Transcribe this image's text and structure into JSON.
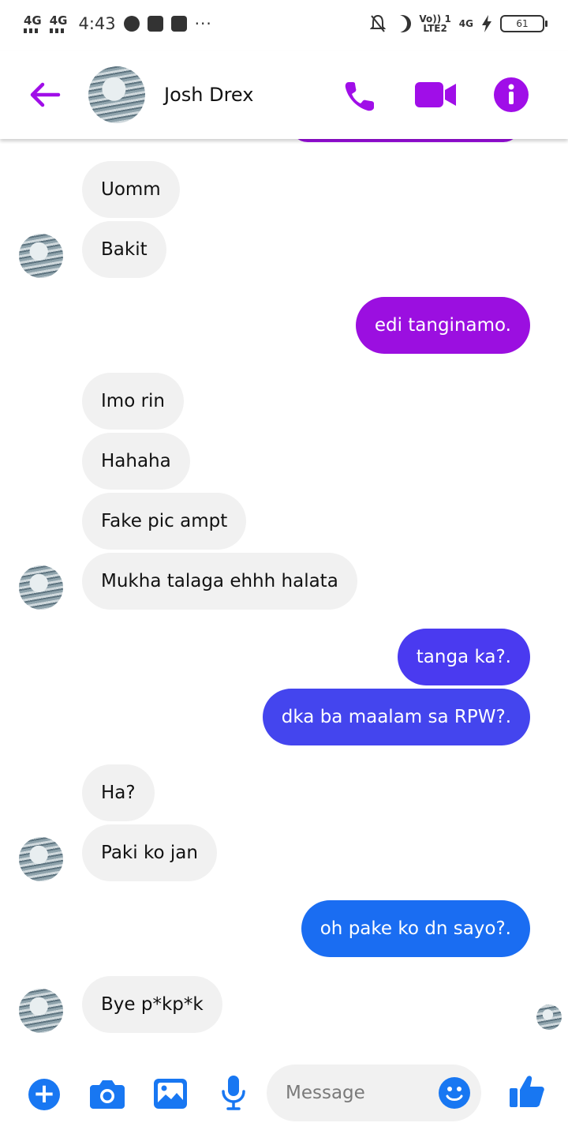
{
  "status_bar": {
    "network_1": "4G",
    "network_2": "4G",
    "time": "4:43",
    "volte_line1": "Vo)) 1",
    "volte_line2": "LTE2",
    "network_3": "4G",
    "battery": "61"
  },
  "header": {
    "contact_name": "Josh Drex"
  },
  "messages": [
    {
      "side": "in",
      "text": "Uomm"
    },
    {
      "side": "in",
      "text": "Bakit"
    },
    {
      "side": "out",
      "text": "edi tanginamo.",
      "color": "#9b0fe0"
    },
    {
      "side": "in",
      "text": "Imo rin"
    },
    {
      "side": "in",
      "text": "Hahaha"
    },
    {
      "side": "in",
      "text": "Fake pic ampt"
    },
    {
      "side": "in",
      "text": "Mukha talaga ehhh halata"
    },
    {
      "side": "out",
      "text": "tanga ka?.",
      "color": "#4a3af0"
    },
    {
      "side": "out",
      "text": "dka ba maalam sa RPW?.",
      "color": "#4445ee"
    },
    {
      "side": "in",
      "text": "Ha?"
    },
    {
      "side": "in",
      "text": "Paki ko jan"
    },
    {
      "side": "out",
      "text": "oh pake ko dn sayo?.",
      "color": "#1a6df2"
    },
    {
      "side": "in",
      "text": "Bye p*kp*k"
    }
  ],
  "composer": {
    "placeholder": "Message"
  },
  "colors": {
    "accent_purple": "#a00ee8",
    "accent_blue": "#1877f2",
    "incoming_bubble": "#f1f1f1"
  },
  "icons": [
    "back-arrow-icon",
    "phone-icon",
    "video-camera-icon",
    "info-icon",
    "plus-icon",
    "camera-icon",
    "gallery-icon",
    "microphone-icon",
    "emoji-icon",
    "thumbs-up-icon"
  ]
}
